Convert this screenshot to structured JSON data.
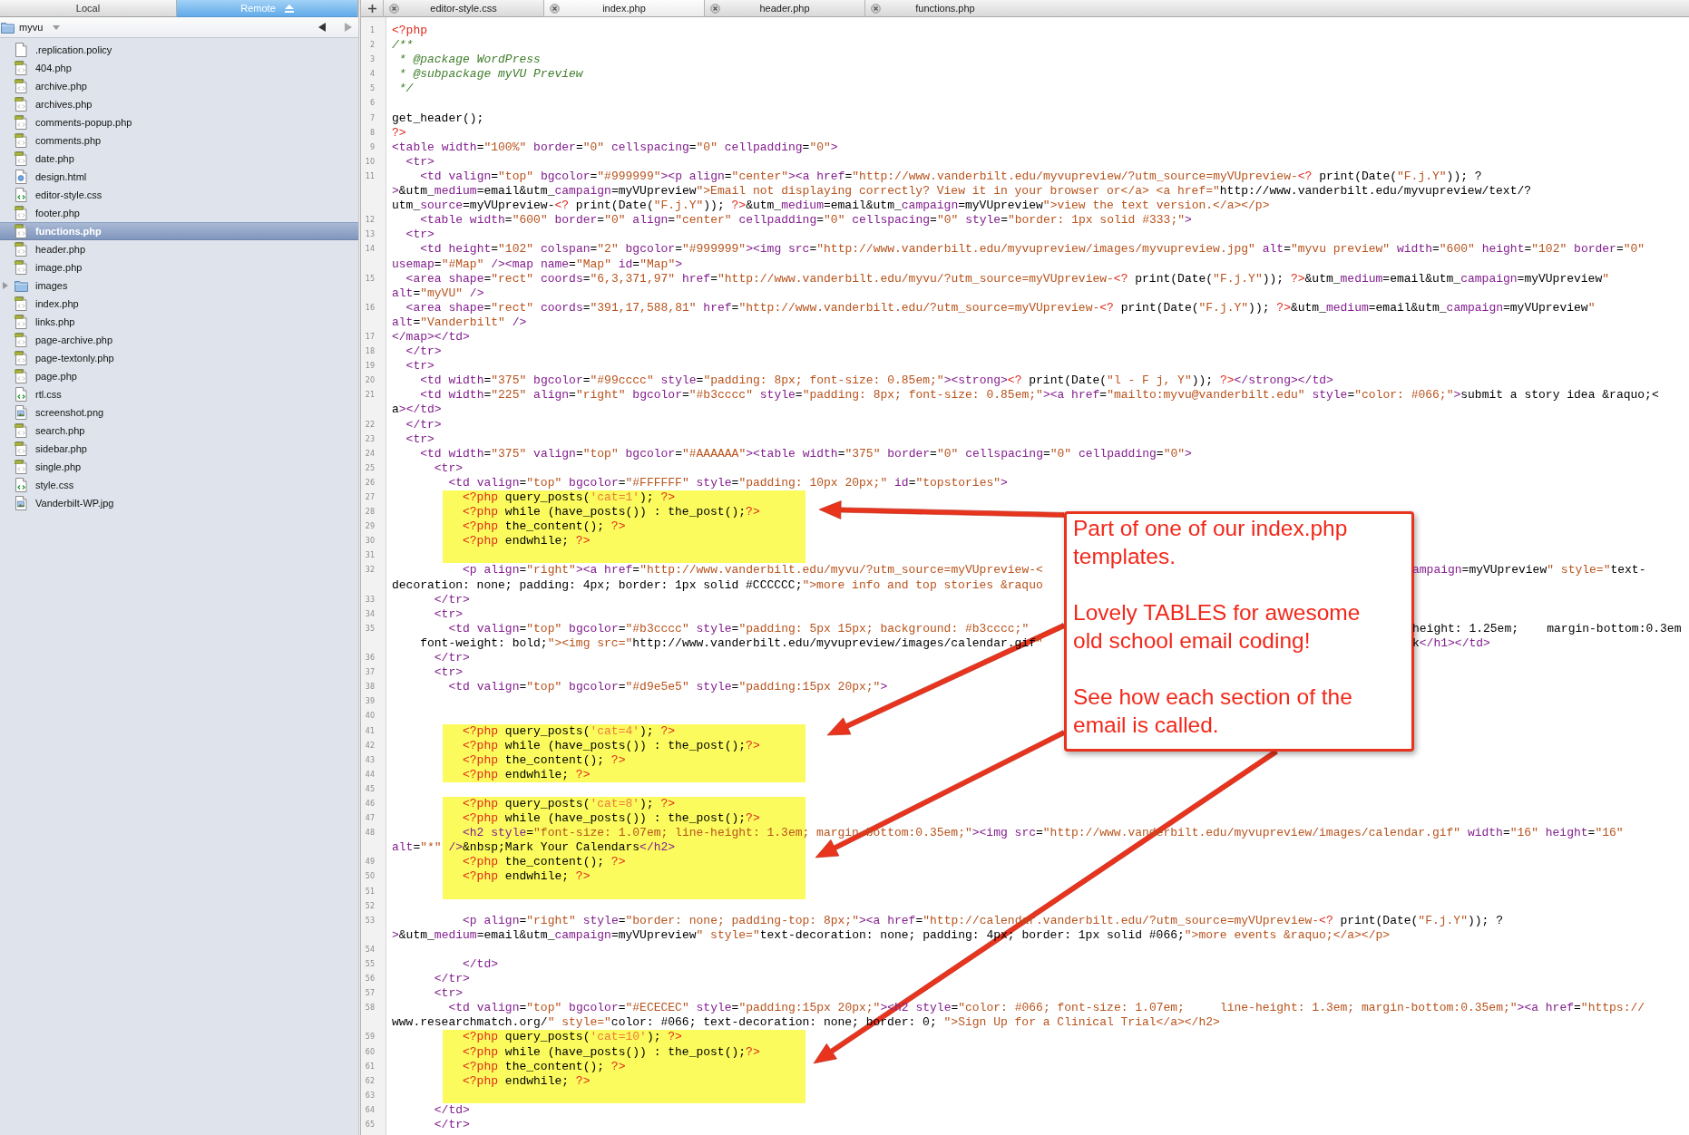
{
  "sidebar": {
    "panes": [
      {
        "label": "Local",
        "selected": false
      },
      {
        "label": "Remote",
        "selected": true
      }
    ],
    "folder": {
      "name": "myvu"
    },
    "history_buttons": [
      {
        "kind": "back",
        "disabled": false
      },
      {
        "kind": "forward",
        "disabled": true
      }
    ],
    "items": [
      {
        "name": ".replication.policy",
        "kind": "document",
        "selected": false
      },
      {
        "name": "404.php",
        "kind": "php",
        "selected": false
      },
      {
        "name": "archive.php",
        "kind": "php",
        "selected": false
      },
      {
        "name": "archives.php",
        "kind": "php",
        "selected": false
      },
      {
        "name": "comments-popup.php",
        "kind": "php",
        "selected": false
      },
      {
        "name": "comments.php",
        "kind": "php",
        "selected": false
      },
      {
        "name": "date.php",
        "kind": "php",
        "selected": false
      },
      {
        "name": "design.html",
        "kind": "html",
        "selected": false
      },
      {
        "name": "editor-style.css",
        "kind": "css",
        "selected": false
      },
      {
        "name": "footer.php",
        "kind": "php",
        "selected": false
      },
      {
        "name": "functions.php",
        "kind": "php",
        "selected": true
      },
      {
        "name": "header.php",
        "kind": "php",
        "selected": false
      },
      {
        "name": "image.php",
        "kind": "php",
        "selected": false
      },
      {
        "name": "images",
        "kind": "folder",
        "selected": false,
        "expanded": false
      },
      {
        "name": "index.php",
        "kind": "php",
        "selected": false
      },
      {
        "name": "links.php",
        "kind": "php",
        "selected": false
      },
      {
        "name": "page-archive.php",
        "kind": "php",
        "selected": false
      },
      {
        "name": "page-textonly.php",
        "kind": "php",
        "selected": false
      },
      {
        "name": "page.php",
        "kind": "php",
        "selected": false
      },
      {
        "name": "rtl.css",
        "kind": "css",
        "selected": false
      },
      {
        "name": "screenshot.png",
        "kind": "image",
        "selected": false
      },
      {
        "name": "search.php",
        "kind": "php",
        "selected": false
      },
      {
        "name": "sidebar.php",
        "kind": "php",
        "selected": false
      },
      {
        "name": "single.php",
        "kind": "php",
        "selected": false
      },
      {
        "name": "style.css",
        "kind": "css",
        "selected": false
      },
      {
        "name": "Vanderbilt-WP.jpg",
        "kind": "image",
        "selected": false
      }
    ]
  },
  "editor": {
    "tabs": [
      {
        "label": "editor-style.css",
        "selected": false
      },
      {
        "label": "index.php",
        "selected": true
      },
      {
        "label": "header.php",
        "selected": false
      },
      {
        "label": "functions.php",
        "selected": false
      }
    ],
    "lines": [
      {
        "number": "1",
        "highlighted": false,
        "rows": [
          "<?php"
        ]
      },
      {
        "number": "2",
        "highlighted": false,
        "rows": [
          "/**"
        ]
      },
      {
        "number": "3",
        "highlighted": false,
        "rows": [
          " * @package WordPress"
        ]
      },
      {
        "number": "4",
        "highlighted": false,
        "rows": [
          " * @subpackage myVU Preview"
        ]
      },
      {
        "number": "5",
        "highlighted": false,
        "rows": [
          " */"
        ]
      },
      {
        "number": "6",
        "highlighted": false
      },
      {
        "number": "7",
        "highlighted": false,
        "rows": [
          "get_header();"
        ]
      },
      {
        "number": "8",
        "highlighted": false,
        "rows": [
          "?>"
        ]
      },
      {
        "number": "9",
        "highlighted": false,
        "rows": [
          "<table width=\"100%\" border=\"0\" cellspacing=\"0\" cellpadding=\"0\">"
        ]
      },
      {
        "number": "10",
        "highlighted": false,
        "rows": [
          "  <tr>"
        ]
      },
      {
        "number": "11",
        "highlighted": false,
        "rows": [
          "    <td valign=\"top\" bgcolor=\"#999999\"><p align=\"center\"><a href=\"http://www.vanderbilt.edu/myvupreview/?utm_source=myVUpreview-<? print(Date(\"F.j.Y\")); ?",
          ">&utm_medium=email&utm_campaign=myVUpreview\">Email not displaying correctly? View it in your browser or</a> <a href=\"http://www.vanderbilt.edu/myvupreview/text/?",
          "utm_source=myVUpreview-<? print(Date(\"F.j.Y\")); ?>&utm_medium=email&utm_campaign=myVUpreview\">view the text version.</a></p>"
        ]
      },
      {
        "number": "12",
        "highlighted": false,
        "rows": [
          "    <table width=\"600\" border=\"0\" align=\"center\" cellpadding=\"0\" cellspacing=\"0\" style=\"border: 1px solid #333;\">"
        ]
      },
      {
        "number": "13",
        "highlighted": false,
        "rows": [
          "  <tr>"
        ]
      },
      {
        "number": "14",
        "highlighted": false,
        "rows": [
          "    <td height=\"102\" colspan=\"2\" bgcolor=\"#999999\"><img src=\"http://www.vanderbilt.edu/myvupreview/images/myvupreview.jpg\" alt=\"myvu preview\" width=\"600\" height=\"102\" border=\"0\"",
          "usemap=\"#Map\" /><map name=\"Map\" id=\"Map\">"
        ]
      },
      {
        "number": "15",
        "highlighted": false,
        "rows": [
          "  <area shape=\"rect\" coords=\"6,3,371,97\" href=\"http://www.vanderbilt.edu/myvu/?utm_source=myVUpreview-<? print(Date(\"F.j.Y\")); ?>&utm_medium=email&utm_campaign=myVUpreview\"",
          "alt=\"myVU\" />"
        ]
      },
      {
        "number": "16",
        "highlighted": false,
        "rows": [
          "  <area shape=\"rect\" coords=\"391,17,588,81\" href=\"http://www.vanderbilt.edu/?utm_source=myVUpreview-<? print(Date(\"F.j.Y\")); ?>&utm_medium=email&utm_campaign=myVUpreview\"",
          "alt=\"Vanderbilt\" />"
        ]
      },
      {
        "number": "17",
        "highlighted": false,
        "rows": [
          "</map></td>"
        ]
      },
      {
        "number": "18",
        "highlighted": false,
        "rows": [
          "  </tr>"
        ]
      },
      {
        "number": "19",
        "highlighted": false,
        "rows": [
          "  <tr>"
        ]
      },
      {
        "number": "20",
        "highlighted": false,
        "rows": [
          "    <td width=\"375\" bgcolor=\"#99cccc\" style=\"padding: 8px; font-size: 0.85em;\"><strong><? print(Date(\"l - F j, Y\")); ?></strong></td>"
        ]
      },
      {
        "number": "21",
        "highlighted": false,
        "rows": [
          "    <td width=\"225\" align=\"right\" bgcolor=\"#b3cccc\" style=\"padding: 8px; font-size: 0.85em;\"><a href=\"mailto:myvu@vanderbilt.edu\" style=\"color: #066;\">submit a story idea &raquo;<",
          "a></td>"
        ]
      },
      {
        "number": "22",
        "highlighted": false,
        "rows": [
          "  </tr>"
        ]
      },
      {
        "number": "23",
        "highlighted": false,
        "rows": [
          "  <tr>"
        ]
      },
      {
        "number": "24",
        "highlighted": false,
        "rows": [
          "    <td width=\"375\" valign=\"top\" bgcolor=\"#AAAAAA\"><table width=\"375\" border=\"0\" cellspacing=\"0\" cellpadding=\"0\">"
        ]
      },
      {
        "number": "25",
        "highlighted": false,
        "rows": [
          "      <tr>"
        ]
      },
      {
        "number": "26",
        "highlighted": false,
        "rows": [
          "        <td valign=\"top\" bgcolor=\"#FFFFFF\" style=\"padding: 10px 20px;\" id=\"topstories\">"
        ]
      },
      {
        "number": "27",
        "highlighted": true,
        "rows": [
          "          <?php query_posts('cat=1'); ?>"
        ]
      },
      {
        "number": "28",
        "highlighted": true,
        "rows": [
          "          <?php while (have_posts()) : the_post();?>"
        ]
      },
      {
        "number": "29",
        "highlighted": true,
        "rows": [
          "          <?php the_content(); ?>"
        ]
      },
      {
        "number": "30",
        "highlighted": true,
        "rows": [
          "          <?php endwhile; ?>"
        ]
      },
      {
        "number": "31",
        "highlighted": true
      },
      {
        "number": "32",
        "highlighted": false,
        "rows": [
          [
            "          <p align=\"right\"><a href=\"http://www.vanderbilt.edu/myvu/?utm_source=myVUpreview-<",
            "ampaign=myVUpreview\" style=\"text-"
          ],
          "decoration: none; padding: 4px; border: 1px solid #CCCCCC;\">more info and top stories &raquo"
        ]
      },
      {
        "number": "33",
        "highlighted": false,
        "rows": [
          "      </tr>"
        ]
      },
      {
        "number": "34",
        "highlighted": false,
        "rows": [
          "      <tr>"
        ]
      },
      {
        "number": "35",
        "highlighted": false,
        "rows": [
          [
            "        <td valign=\"top\" bgcolor=\"#b3cccc\" style=\"padding: 5px 15px; background: #b3cccc;\"",
            "height: 1.25em;    margin-bottom:0.3em"
          ],
          [
            "    font-weight: bold;\"><img src=\"http://www.vanderbilt.edu/myvupreview/images/calendar.gif\"",
            "k</h1></td>"
          ]
        ]
      },
      {
        "number": "36",
        "highlighted": false,
        "rows": [
          "      </tr>"
        ]
      },
      {
        "number": "37",
        "highlighted": false,
        "rows": [
          "      <tr>"
        ]
      },
      {
        "number": "38",
        "highlighted": false,
        "rows": [
          "        <td valign=\"top\" bgcolor=\"#d9e5e5\" style=\"padding:15px 20px;\">"
        ]
      },
      {
        "number": "39",
        "highlighted": false
      },
      {
        "number": "40",
        "highlighted": false
      },
      {
        "number": "41",
        "highlighted": true,
        "rows": [
          "          <?php query_posts('cat=4'); ?>"
        ]
      },
      {
        "number": "42",
        "highlighted": true,
        "rows": [
          "          <?php while (have_posts()) : the_post();?>"
        ]
      },
      {
        "number": "43",
        "highlighted": true,
        "rows": [
          "          <?php the_content(); ?>"
        ]
      },
      {
        "number": "44",
        "highlighted": true,
        "rows": [
          "          <?php endwhile; ?>"
        ]
      },
      {
        "number": "45",
        "highlighted": false
      },
      {
        "number": "46",
        "highlighted": true,
        "rows": [
          "          <?php query_posts('cat=8'); ?>"
        ]
      },
      {
        "number": "47",
        "highlighted": true,
        "rows": [
          "          <?php while (have_posts()) : the_post();?>"
        ]
      },
      {
        "number": "48",
        "highlighted": true,
        "rows": [
          "          <h2 style=\"font-size: 1.07em; line-height: 1.3em; margin-bottom:0.35em;\"><img src=\"http://www.vanderbilt.edu/myvupreview/images/calendar.gif\" width=\"16\" height=\"16\"",
          "alt=\"*\" />&nbsp;Mark Your Calendars</h2>"
        ]
      },
      {
        "number": "49",
        "highlighted": true,
        "rows": [
          "          <?php the_content(); ?>"
        ]
      },
      {
        "number": "50",
        "highlighted": true,
        "rows": [
          "          <?php endwhile; ?>"
        ]
      },
      {
        "number": "51",
        "highlighted": true
      },
      {
        "number": "52",
        "highlighted": false
      },
      {
        "number": "53",
        "highlighted": false,
        "rows": [
          "          <p align=\"right\" style=\"border: none; padding-top: 8px;\"><a href=\"http://calendar.vanderbilt.edu/?utm_source=myVUpreview-<? print(Date(\"F.j.Y\")); ?",
          ">&utm_medium=email&utm_campaign=myVUpreview\" style=\"text-decoration: none; padding: 4px; border: 1px solid #066;\">more events &raquo;</a></p>"
        ]
      },
      {
        "number": "54",
        "highlighted": false
      },
      {
        "number": "55",
        "highlighted": false,
        "rows": [
          "          </td>"
        ]
      },
      {
        "number": "56",
        "highlighted": false,
        "rows": [
          "      </tr>"
        ]
      },
      {
        "number": "57",
        "highlighted": false,
        "rows": [
          "      <tr>"
        ]
      },
      {
        "number": "58",
        "highlighted": false,
        "rows": [
          "        <td valign=\"top\" bgcolor=\"#ECECEC\" style=\"padding:15px 20px;\"><h2 style=\"color: #066; font-size: 1.07em;     line-height: 1.3em; margin-bottom:0.35em;\"><a href=\"https://",
          "www.researchmatch.org/\" style=\"color: #066; text-decoration: none; border: 0; \">Sign Up for a Clinical Trial</a></h2>"
        ]
      },
      {
        "number": "59",
        "highlighted": true,
        "rows": [
          "          <?php query_posts('cat=10'); ?>"
        ]
      },
      {
        "number": "60",
        "highlighted": true,
        "rows": [
          "          <?php while (have_posts()) : the_post();?>"
        ]
      },
      {
        "number": "61",
        "highlighted": true,
        "rows": [
          "          <?php the_content(); ?>"
        ]
      },
      {
        "number": "62",
        "highlighted": true,
        "rows": [
          "          <?php endwhile; ?>"
        ]
      },
      {
        "number": "63",
        "highlighted": true
      },
      {
        "number": "64",
        "highlighted": false,
        "rows": [
          "      </td>"
        ]
      },
      {
        "number": "65",
        "highlighted": false,
        "rows": [
          "      </tr>"
        ]
      }
    ]
  },
  "callout": {
    "paragraphs": [
      "Part of one of our index.php templates.",
      "Lovely TABLES for awesome old school email coding!",
      "See how each section of the email is called."
    ]
  }
}
